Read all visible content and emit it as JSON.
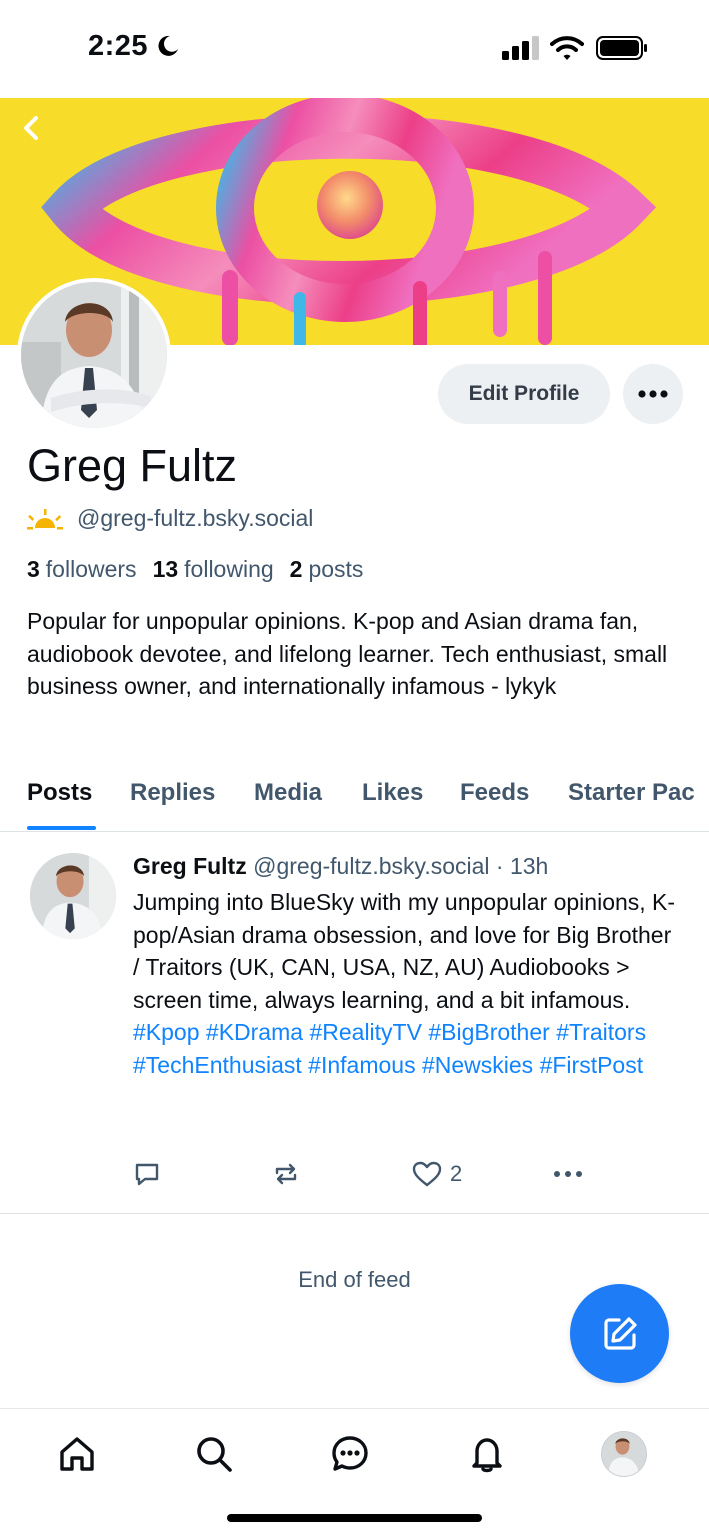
{
  "status_bar": {
    "time": "2:25",
    "icons": [
      "moon-icon",
      "signal-icon",
      "wifi-icon",
      "battery-icon"
    ]
  },
  "profile": {
    "name": "Greg Fultz",
    "handle": "@greg-fultz.bsky.social",
    "followers_count": "3",
    "followers_label": "followers",
    "following_count": "13",
    "following_label": "following",
    "posts_count": "2",
    "posts_label": "posts",
    "bio": "Popular for unpopular opinions. K-pop and Asian drama fan, audiobook devotee, and lifelong learner. Tech enthusiast, small business owner, and internationally infamous - lykyk",
    "edit_label": "Edit Profile"
  },
  "tabs": [
    {
      "label": "Posts",
      "active": true
    },
    {
      "label": "Replies"
    },
    {
      "label": "Media"
    },
    {
      "label": "Likes"
    },
    {
      "label": "Feeds"
    },
    {
      "label": "Starter Pac"
    }
  ],
  "post": {
    "author": "Greg Fultz",
    "handle": "@greg-fultz.bsky.social",
    "time": "13h",
    "separator": "·",
    "text": "Jumping into BlueSky with my unpopular opinions, K-pop/Asian drama obsession, and love for Big Brother / Traitors (UK, CAN, USA, NZ, AU) Audiobooks > screen time, always learning, and a bit infamous.",
    "hashtags": [
      "#Kpop",
      "#KDrama",
      "#RealityTV",
      "#BigBrother",
      "#Traitors",
      "#TechEnthusiast",
      "#Infamous",
      "#Newskies",
      "#FirstPost"
    ],
    "like_count": "2"
  },
  "feed": {
    "end_label": "End of feed"
  },
  "colors": {
    "accent": "#1083fe",
    "fab": "#1e7cf6",
    "banner": "#f7dc2a",
    "muted": "#42576c"
  },
  "bottom_nav": [
    "home-icon",
    "search-icon",
    "chat-icon",
    "bell-icon",
    "profile-avatar"
  ]
}
